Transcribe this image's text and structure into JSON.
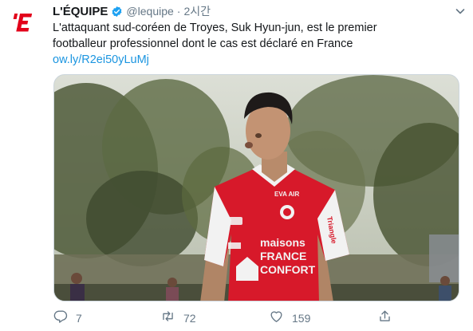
{
  "tweet": {
    "display_name": "L'ÉQUIPE",
    "handle": "@lequipe",
    "separator": "·",
    "time": "2시간",
    "text_lines": [
      "L'attaquant sud-coréen de Troyes, Suk Hyun-jun, est le premier",
      "footballeur professionnel dont le cas est déclaré en France"
    ],
    "link": "ow.ly/R2ei50yLuMj"
  },
  "avatar": {
    "logo_text": "'E",
    "color": "#e2001a"
  },
  "media": {
    "jersey_sponsor_line1": "maisons",
    "jersey_sponsor_line2": "FRANCE",
    "jersey_sponsor_line3": "CONFORT",
    "jersey_chest_right": "EVA AIR",
    "jersey_sleeve": "Triangle",
    "kit_color": "#d7192a"
  },
  "actions": {
    "reply_count": "7",
    "retweet_count": "72",
    "like_count": "159"
  },
  "colors": {
    "accent": "#1b95e0",
    "muted": "#657786",
    "verified": "#1da1f2"
  },
  "icons": [
    "lequipe-logo-icon",
    "verified-badge-icon",
    "chevron-down-icon",
    "reply-icon",
    "retweet-icon",
    "like-icon",
    "share-icon"
  ]
}
